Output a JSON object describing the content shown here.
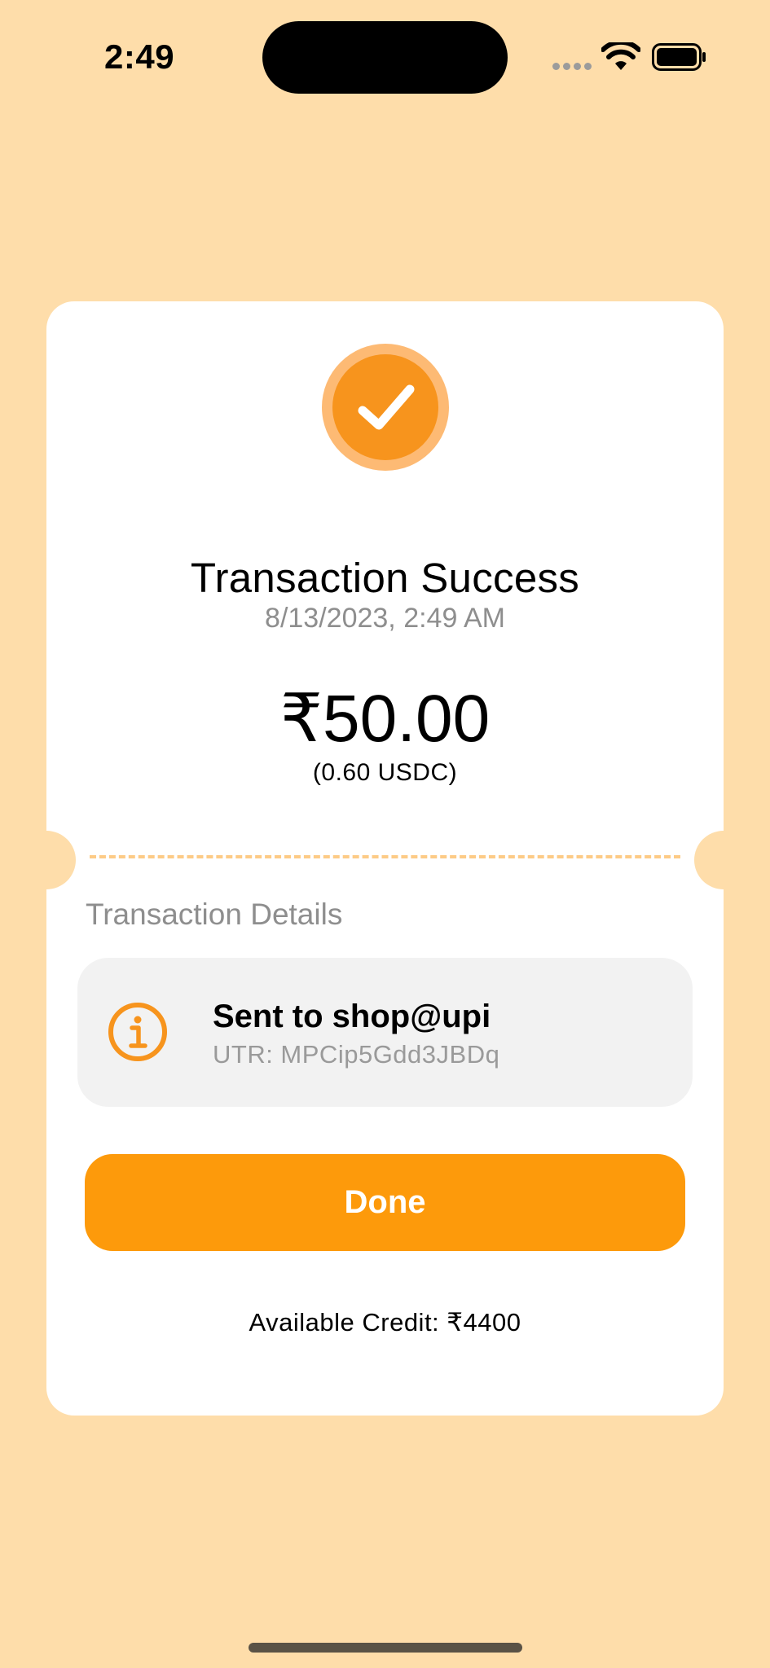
{
  "status_bar": {
    "time": "2:49"
  },
  "success_icon": {
    "icon": "checkmark-icon",
    "color": "#F7941D"
  },
  "transaction": {
    "title": "Transaction Success",
    "datetime": "8/13/2023, 2:49 AM",
    "amount": "₹50.00",
    "amount_usdc": "(0.60 USDC)"
  },
  "details": {
    "section_label": "Transaction Details",
    "icon": "info-icon",
    "recipient": "Sent to shop@upi",
    "utr": "UTR: MPCip5Gdd3JBDq"
  },
  "actions": {
    "done_label": "Done"
  },
  "footer": {
    "available_credit": "Available Credit: ₹4400"
  },
  "colors": {
    "background": "#FEDDAA",
    "accent": "#FD9A0B"
  }
}
